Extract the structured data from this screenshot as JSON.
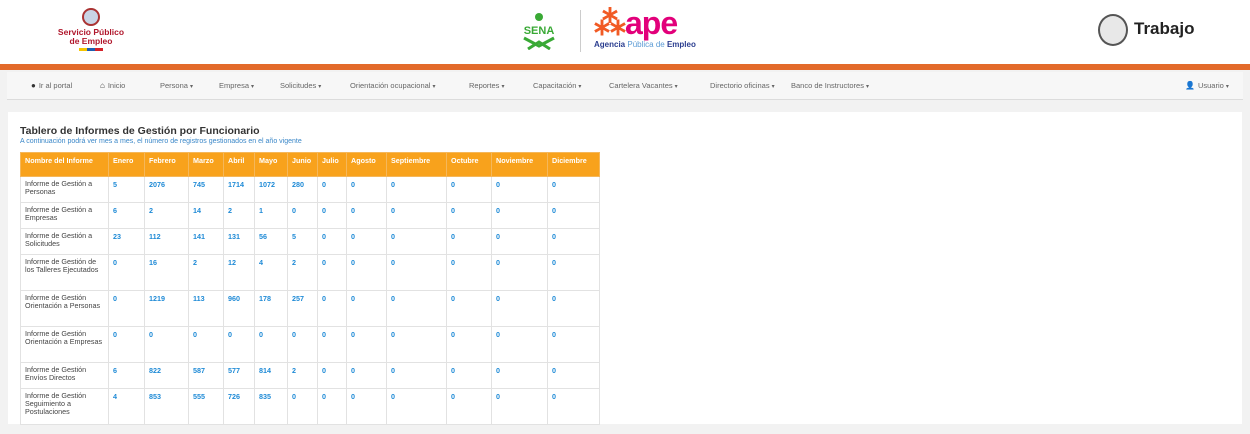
{
  "header": {
    "left_logo_line1": "Servicio Público",
    "left_logo_line2": "de Empleo",
    "sena_label": "SENA",
    "ape_word": "ape",
    "ape_sub_bold": "Agencia",
    "ape_sub_light": "Pública de",
    "ape_sub_bold2": "Empleo",
    "right_logo": "Trabajo"
  },
  "nav": {
    "items": [
      {
        "label": "Ir al portal",
        "icon": "circle-arrow-icon",
        "caret": false
      },
      {
        "label": "Inicio",
        "icon": "home-icon",
        "caret": false
      },
      {
        "label": "Persona",
        "caret": true
      },
      {
        "label": "Empresa",
        "caret": true
      },
      {
        "label": "Solicitudes",
        "caret": true
      },
      {
        "label": "Orientación ocupacional",
        "caret": true
      },
      {
        "label": "Reportes",
        "caret": true
      },
      {
        "label": "Capacitación",
        "caret": true
      },
      {
        "label": "Cartelera Vacantes",
        "caret": true
      },
      {
        "label": "Directorio oficinas",
        "caret": true
      },
      {
        "label": "Banco de Instructores",
        "caret": true
      }
    ],
    "user": {
      "label": "Usuario",
      "icon": "user-icon"
    }
  },
  "main": {
    "title": "Tablero de Informes de Gestión por Funcionario",
    "subtitle": "A continuación podrá ver mes a mes, el número de registros gestionados en el año vigente",
    "columns": [
      "Nombre del Informe",
      "Enero",
      "Febrero",
      "Marzo",
      "Abril",
      "Mayo",
      "Junio",
      "Julio",
      "Agosto",
      "Septiembre",
      "Octubre",
      "Noviembre",
      "Diciembre"
    ],
    "rows": [
      {
        "name": "Informe de Gestión a Personas",
        "values": [
          "5",
          "2076",
          "745",
          "1714",
          "1072",
          "280",
          "0",
          "0",
          "0",
          "0",
          "0",
          "0"
        ]
      },
      {
        "name": "Informe de Gestión a Empresas",
        "values": [
          "6",
          "2",
          "14",
          "2",
          "1",
          "0",
          "0",
          "0",
          "0",
          "0",
          "0",
          "0"
        ]
      },
      {
        "name": "Informe de Gestión a Solicitudes",
        "values": [
          "23",
          "112",
          "141",
          "131",
          "56",
          "5",
          "0",
          "0",
          "0",
          "0",
          "0",
          "0"
        ]
      },
      {
        "name": "Informe de Gestión de los Talleres Ejecutados",
        "values": [
          "0",
          "16",
          "2",
          "12",
          "4",
          "2",
          "0",
          "0",
          "0",
          "0",
          "0",
          "0"
        ]
      },
      {
        "name": "Informe de Gestión Orientación a Personas",
        "values": [
          "0",
          "1219",
          "113",
          "960",
          "178",
          "257",
          "0",
          "0",
          "0",
          "0",
          "0",
          "0"
        ]
      },
      {
        "name": "Informe de Gestión Orientación a Empresas",
        "values": [
          "0",
          "0",
          "0",
          "0",
          "0",
          "0",
          "0",
          "0",
          "0",
          "0",
          "0",
          "0"
        ]
      },
      {
        "name": "Informe de Gestión Envíos Directos",
        "values": [
          "6",
          "822",
          "587",
          "577",
          "814",
          "2",
          "0",
          "0",
          "0",
          "0",
          "0",
          "0"
        ]
      },
      {
        "name": "Informe de Gestión Seguimiento a Postulaciones",
        "values": [
          "4",
          "853",
          "555",
          "726",
          "835",
          "0",
          "0",
          "0",
          "0",
          "0",
          "0",
          "0"
        ]
      }
    ]
  },
  "colors": {
    "accent": "#f8a21c",
    "header_bar": "#e36a2a",
    "link": "#1e8ad6"
  }
}
